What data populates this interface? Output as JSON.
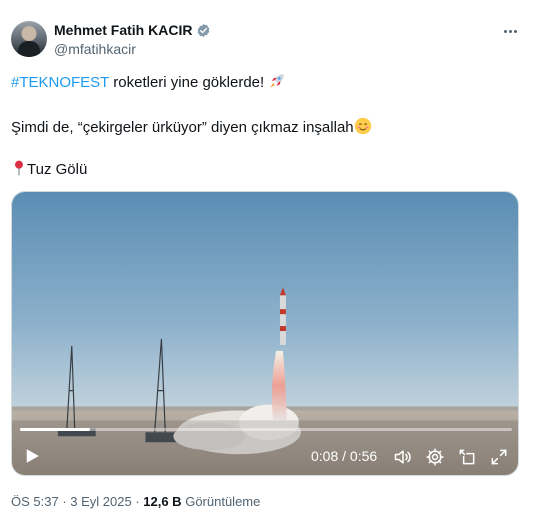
{
  "author": {
    "name": "Mehmet Fatih KACIR",
    "handle": "@mfatihkacir",
    "verified_icon": "verified-badge-icon"
  },
  "tweet": {
    "hashtag": "#TEKNOFEST",
    "line1_rest": " roketleri yine göklerde! ",
    "line1_emoji": "rocket-icon",
    "line2": "Şimdi de, “çekirgeler ürküyor” diyen çıkmaz inşallah",
    "line2_emoji": "smiling-face-icon",
    "location_emoji": "pin-icon",
    "location": "Tuz Gölü"
  },
  "video": {
    "time": "0:08 / 0:56",
    "progress": 0.143,
    "controls": [
      "play-icon",
      "volume-icon",
      "settings-icon",
      "pip-icon",
      "fullscreen-icon"
    ]
  },
  "footer": {
    "time_label": "ÖS 5:37",
    "separator": " · ",
    "date": "3 Eyl 2025",
    "views_count": "12,6 B",
    "views_label": "Görüntüleme"
  },
  "colors": {
    "link": "#1d9bf0",
    "text": "#0f1419",
    "secondary": "#536471",
    "sky_top": "#5f8fb3",
    "ground": "#b6aea4"
  }
}
